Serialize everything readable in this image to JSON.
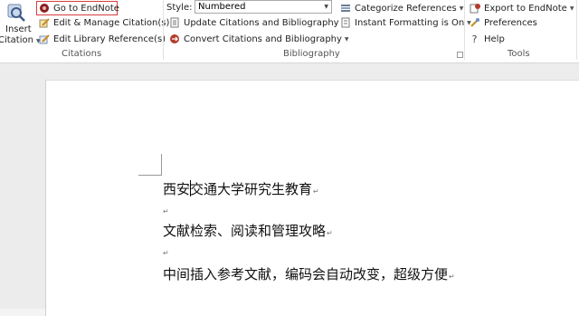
{
  "ribbon": {
    "insert_citation": {
      "line1": "Insert",
      "line2": "Citation"
    },
    "citations": {
      "go_to_endnote": "Go to EndNote",
      "edit_manage": "Edit & Manage Citation(s)",
      "edit_library": "Edit Library Reference(s)",
      "group_label": "Citations"
    },
    "bibliography": {
      "style_label": "Style:",
      "style_value": "Numbered",
      "update": "Update Citations and Bibliography",
      "convert": "Convert Citations and Bibliography",
      "categorize": "Categorize References",
      "instant_formatting": "Instant Formatting is On",
      "group_label": "Bibliography"
    },
    "tools": {
      "export": "Export to EndNote",
      "preferences": "Preferences",
      "help": "Help",
      "group_label": "Tools"
    }
  },
  "document": {
    "lines": [
      "西安交通大学研究生教育",
      "文献检索、阅读和管理攻略",
      "中间插入参考文献，编码会自动改变，超级方便"
    ],
    "paragraph_mark": "↵"
  },
  "colors": {
    "highlight_border": "#d63c3c"
  }
}
